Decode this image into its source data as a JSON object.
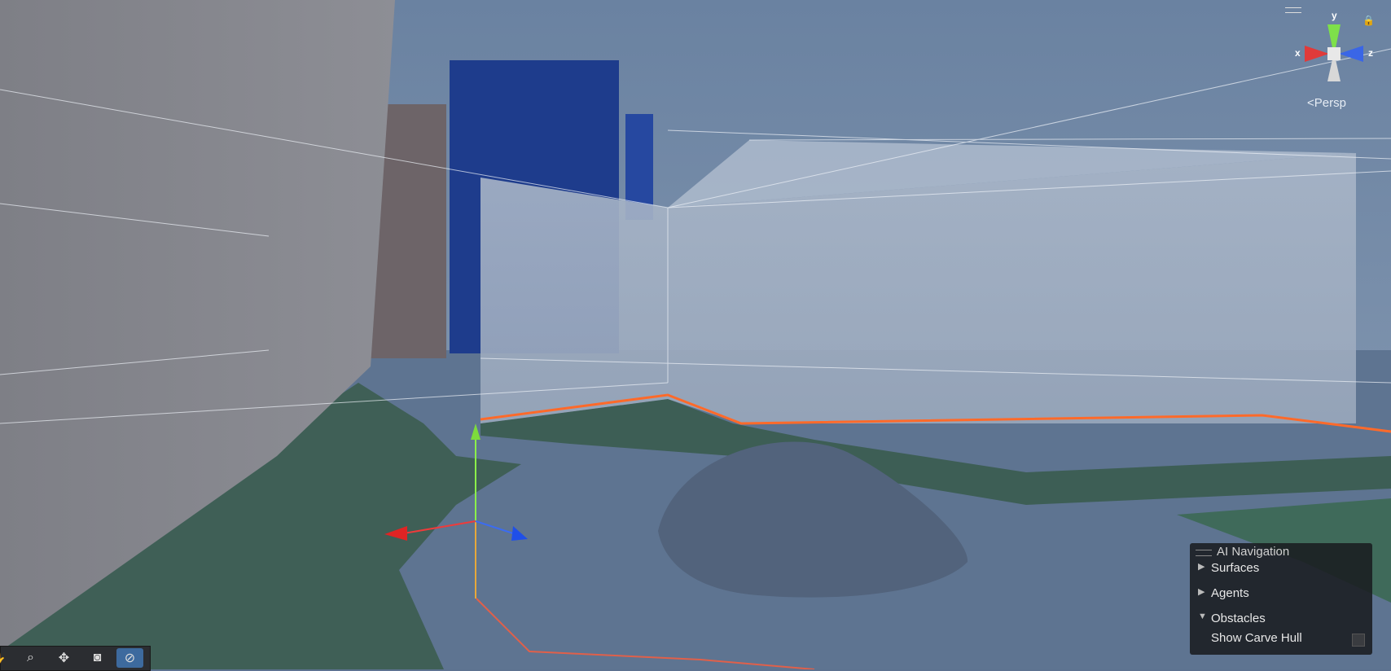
{
  "scene_view": {
    "projection_label": "Persp",
    "axis_labels": {
      "x": "x",
      "y": "y",
      "z": "z"
    }
  },
  "overlay_panel": {
    "title": "AI Navigation",
    "sections": [
      {
        "label": "Surfaces",
        "expanded": false
      },
      {
        "label": "Agents",
        "expanded": false
      },
      {
        "label": "Obstacles",
        "expanded": true
      }
    ],
    "option_label": "Show Carve Hull",
    "option_checked": false
  },
  "toolbar": {
    "tools": [
      {
        "icon": "hand-icon"
      },
      {
        "icon": "search-icon"
      },
      {
        "icon": "move-icon"
      },
      {
        "icon": "camera-icon"
      },
      {
        "icon": "compass-icon",
        "active": true
      }
    ]
  },
  "colors": {
    "sky": "#6f87a6",
    "ground": "#5e7491",
    "navmesh_green": "#3d5e55",
    "wall_blue": "#1e3c8c",
    "orange_outline": "#ff6a2a",
    "panel_bg": "#1a1c20",
    "toolbar_active": "#3d6a9e"
  }
}
